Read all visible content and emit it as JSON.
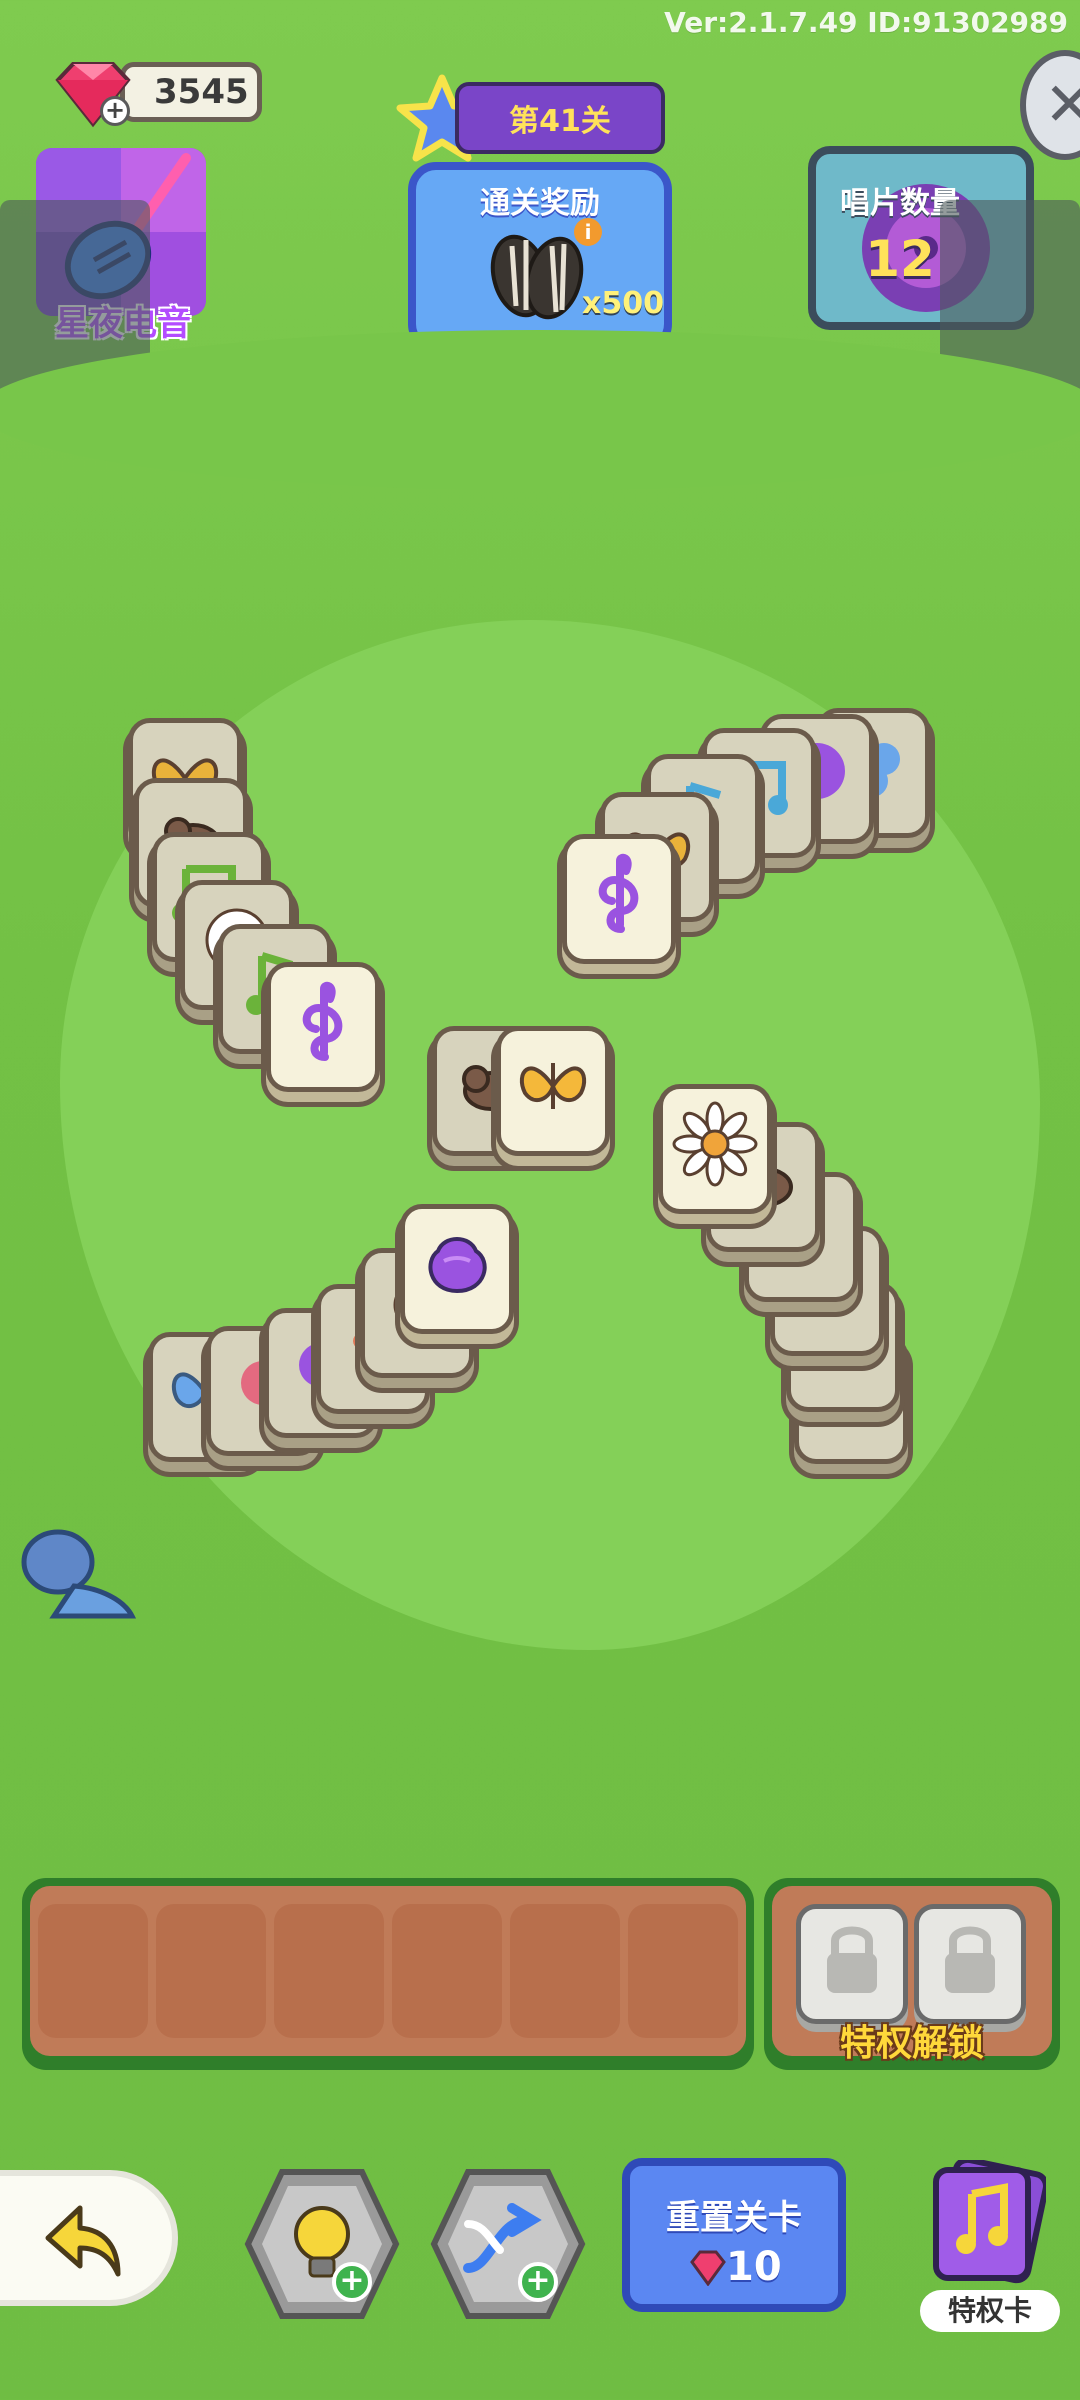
{
  "header": {
    "version": "Ver:2.1.7.49 ID:91302989",
    "gems": "3545",
    "theme_label": "星夜电音",
    "level": "第41关",
    "reward_title": "通关奖励",
    "reward_count": "x500",
    "records_title": "唱片数量",
    "records_count": "12"
  },
  "tray": {
    "slot_count": 6,
    "unlock_label": "特权解锁"
  },
  "controls": {
    "reset_label": "重置关卡",
    "reset_cost": "10",
    "vip_label": "特权卡"
  },
  "tiles_icons": [
    "butterfly",
    "bird",
    "music-note",
    "daisy",
    "treble-clef",
    "purple-flower",
    "pink-flower",
    "blue-flower",
    "leaf"
  ],
  "colors": {
    "grass": "#74c246",
    "tile_face": "#f6f2dc",
    "tile_border": "#6b5b4b",
    "purple": "#9a53e0",
    "blue_button": "#5b87f2"
  }
}
